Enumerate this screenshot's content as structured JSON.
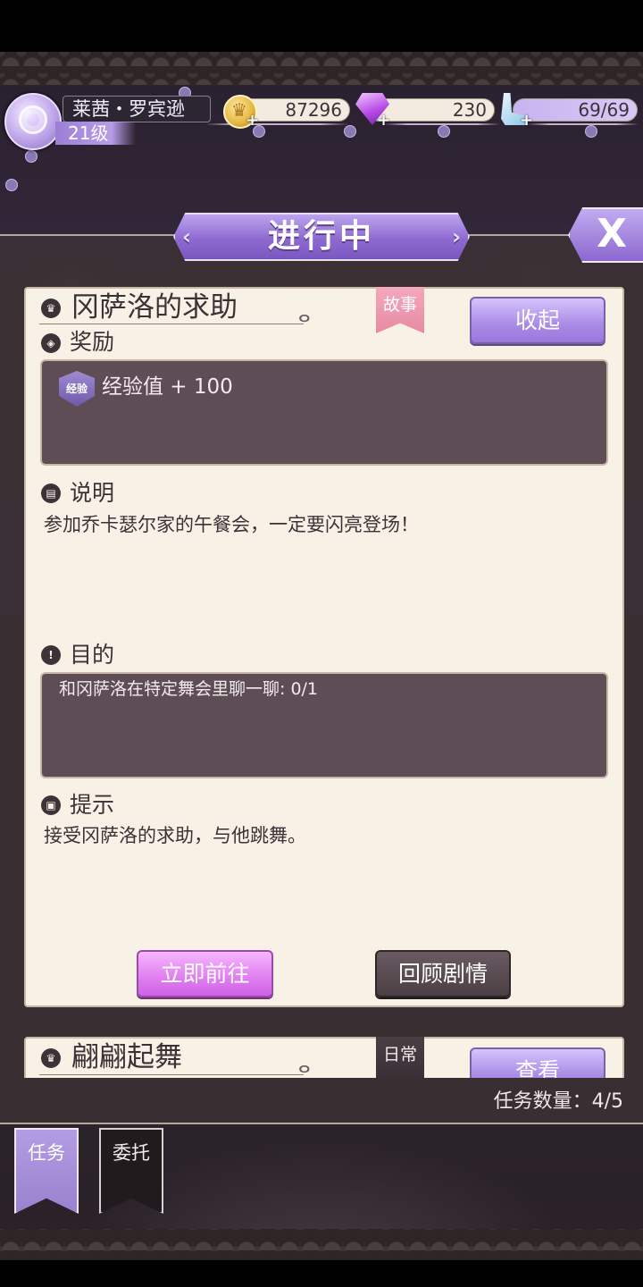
{
  "status": {
    "player_name": "莱茜・罗宾逊",
    "level": "21级",
    "gold": "87296",
    "diamonds": "230",
    "stamina": "69/69"
  },
  "panel": {
    "title": "进行中",
    "close_label": "X",
    "task_count": "任务数量：4/5"
  },
  "quest": {
    "title": "冈萨洛的求助",
    "tag": "故事",
    "collapse_label": "收起",
    "reward_label": "奖励",
    "reward_badge": "经验",
    "reward_text": "经验值 + 100",
    "description_label": "说明",
    "description": "参加乔卡瑟尔家的午餐会，一定要闪亮登场！",
    "goal_label": "目的",
    "goal": "和冈萨洛在特定舞会里聊一聊: 0/1",
    "hint_label": "提示",
    "hint": "接受冈萨洛的求助，与他跳舞。",
    "go_label": "立即前往",
    "review_label": "回顾剧情"
  },
  "quest2": {
    "title": "翩翩起舞",
    "tag": "日常",
    "view_label": "查看"
  },
  "tabs": [
    {
      "label": "任务",
      "active": true
    },
    {
      "label": "委托",
      "active": false
    }
  ]
}
